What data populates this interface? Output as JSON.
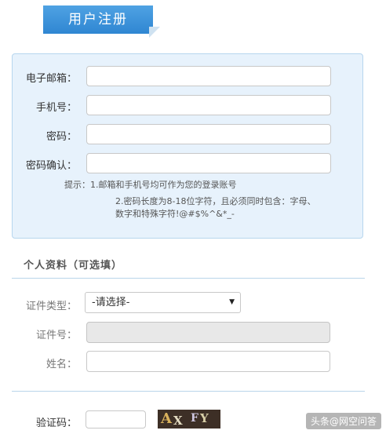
{
  "header": {
    "title": "用户注册"
  },
  "account": {
    "email_label": "电子邮箱：",
    "phone_label": "手机号：",
    "password_label": "密码：",
    "confirm_label": "密码确认：",
    "email_value": "",
    "phone_value": "",
    "password_value": "",
    "confirm_value": "",
    "hint_1": "提示：1.邮箱和手机号均可作为您的登录账号",
    "hint_2a": "2.密码长度为8-18位字符，且必须同时包含：字母、",
    "hint_2b": "数字和特殊字符!@#$%^&*_-"
  },
  "profile": {
    "section_title": "个人资料（可选填）",
    "id_type_label": "证件类型：",
    "id_type_selected": "-请选择-",
    "id_number_label": "证件号：",
    "name_label": "姓名：",
    "id_number_value": "",
    "name_value": ""
  },
  "captcha": {
    "label": "验证码：",
    "value": "",
    "image_text": "AX FY"
  },
  "watermark": {
    "text": "头条@网空问答"
  },
  "colors": {
    "accent": "#3a8fd8",
    "panel_bg": "#e7f2fc",
    "panel_border": "#b7d6ee"
  }
}
